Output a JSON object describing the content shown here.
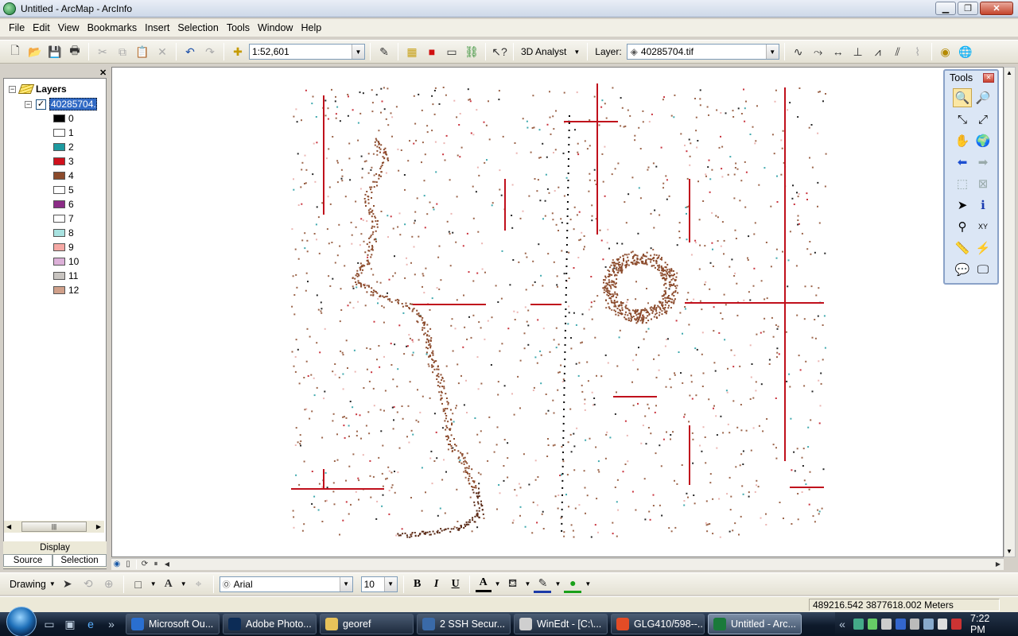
{
  "window": {
    "title": "Untitled - ArcMap - ArcInfo"
  },
  "menu": [
    "File",
    "Edit",
    "View",
    "Bookmarks",
    "Insert",
    "Selection",
    "Tools",
    "Window",
    "Help"
  ],
  "toolbar": {
    "scale_value": "1:52,601",
    "analyst_label": "3D Analyst",
    "layer_label": "Layer:",
    "layer_value": "40285704.tif"
  },
  "toc": {
    "root_label": "Layers",
    "layer_name": "40285704.tif",
    "legend": [
      {
        "label": "0",
        "color": "#000000"
      },
      {
        "label": "1",
        "color": "#ffffff"
      },
      {
        "label": "2",
        "color": "#1e9aa0"
      },
      {
        "label": "3",
        "color": "#d0101c"
      },
      {
        "label": "4",
        "color": "#8b4a2b"
      },
      {
        "label": "5",
        "color": "#ffffff"
      },
      {
        "label": "6",
        "color": "#8b2b86"
      },
      {
        "label": "7",
        "color": "#ffffff"
      },
      {
        "label": "8",
        "color": "#a8e2e0"
      },
      {
        "label": "9",
        "color": "#f5a8a4"
      },
      {
        "label": "10",
        "color": "#dcb0d8"
      },
      {
        "label": "11",
        "color": "#c8c4c0"
      },
      {
        "label": "12",
        "color": "#d0a08a"
      }
    ],
    "tabs": {
      "display": "Display",
      "source": "Source",
      "selection": "Selection"
    }
  },
  "tools_panel": {
    "title": "Tools"
  },
  "drawing": {
    "drawing_label": "Drawing",
    "font_name": "Arial",
    "font_size": "10",
    "bold": "B",
    "italic": "I",
    "underline": "U"
  },
  "status": {
    "coordinates": "489216.542  3877618.002 Meters"
  },
  "taskbar": {
    "tasks": [
      {
        "label": "Microsoft Ou...",
        "color": "#2a6fd0"
      },
      {
        "label": "Adobe Photo...",
        "color": "#0c2c56"
      },
      {
        "label": "georef",
        "color": "#e8c35a"
      },
      {
        "label": "2 SSH Secur...",
        "color": "#3a6aa8"
      },
      {
        "label": "WinEdt - [C:\\...",
        "color": "#cfcfcf"
      },
      {
        "label": "GLG410/598--...",
        "color": "#e34c26"
      },
      {
        "label": "Untitled - Arc...",
        "color": "#1a7a3b"
      }
    ],
    "clock": "7:22 PM"
  }
}
